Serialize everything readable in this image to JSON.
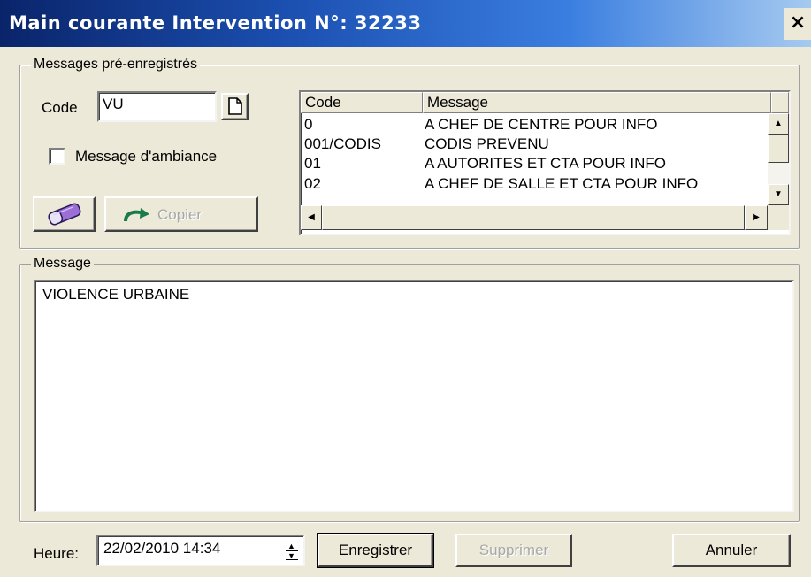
{
  "window": {
    "title": "Main courante Intervention N°: 32233",
    "close_glyph": "×"
  },
  "preset_group": {
    "legend": "Messages pré-enregistrés",
    "code_label": "Code",
    "code_value": "VU",
    "new_icon": "page-icon",
    "ambiance_label": "Message d'ambiance",
    "ambiance_checked": false,
    "eraser_icon": "eraser-icon",
    "copy_label": "Copier",
    "copy_icon": "curved-arrow-icon",
    "grid": {
      "columns": [
        "Code",
        "Message"
      ],
      "rows": [
        {
          "code": "0",
          "message": "A CHEF DE CENTRE POUR INFO"
        },
        {
          "code": "001/CODIS",
          "message": " CODIS PREVENU"
        },
        {
          "code": "01",
          "message": "A AUTORITES  ET CTA POUR INFO"
        },
        {
          "code": "02",
          "message": "A  CHEF DE SALLE ET CTA POUR INFO"
        }
      ]
    }
  },
  "message_group": {
    "legend": "Message",
    "text": "VIOLENCE URBAINE"
  },
  "footer": {
    "heure_label": "Heure:",
    "heure_value": "22/02/2010 14:34",
    "save_label": "Enregistrer",
    "delete_label": "Supprimer",
    "cancel_label": "Annuler"
  },
  "colors": {
    "titlebar_start": "#0a246a",
    "titlebar_end": "#a6caf0",
    "dialog_bg": "#ece9d8",
    "copy_arrow": "#1a7a4a"
  }
}
